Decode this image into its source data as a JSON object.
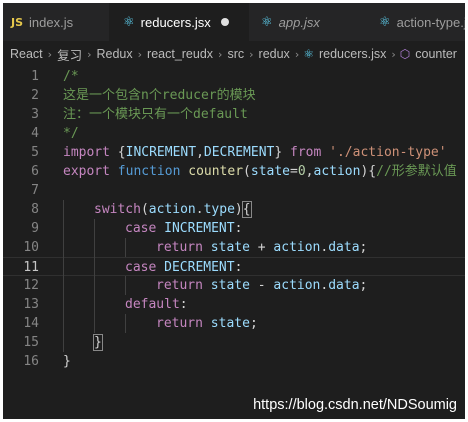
{
  "tabs": [
    {
      "label": "index.js",
      "icon": "js-icon",
      "icon_text": "JS",
      "italic": false,
      "active": false,
      "dirty": false
    },
    {
      "label": "reducers.jsx",
      "icon": "react-icon",
      "icon_text": "⚛",
      "italic": false,
      "active": true,
      "dirty": true
    },
    {
      "label": "app.jsx",
      "icon": "react-icon",
      "icon_text": "⚛",
      "italic": true,
      "active": false,
      "dirty": false
    },
    {
      "label": "action-type.js",
      "icon": "react-icon",
      "icon_text": "⚛",
      "italic": false,
      "active": false,
      "dirty": false
    }
  ],
  "breadcrumb": {
    "items": [
      "React",
      "复习",
      "Redux",
      "react_reudx",
      "src",
      "redux",
      "reducers.jsx",
      "counter"
    ],
    "file_icon": "react-icon",
    "symbol_icon": "cube-icon"
  },
  "editor": {
    "current_line": 11,
    "lines": [
      {
        "n": "1",
        "indent": 0,
        "tokens": [
          {
            "t": "/*",
            "c": "comment"
          }
        ]
      },
      {
        "n": "2",
        "indent": 0,
        "tokens": [
          {
            "t": "这是一个包含n个reducer的模块",
            "c": "comment"
          }
        ]
      },
      {
        "n": "3",
        "indent": 0,
        "tokens": [
          {
            "t": "注：一个模块只有一个default",
            "c": "comment"
          }
        ]
      },
      {
        "n": "4",
        "indent": 0,
        "tokens": [
          {
            "t": "*/",
            "c": "comment"
          }
        ]
      },
      {
        "n": "5",
        "indent": 0,
        "tokens": [
          {
            "t": "import",
            "c": "ctrl"
          },
          {
            "t": " {",
            "c": "punct"
          },
          {
            "t": "INCREMENT",
            "c": "var"
          },
          {
            "t": ",",
            "c": "punct"
          },
          {
            "t": "DECREMENT",
            "c": "var"
          },
          {
            "t": "} ",
            "c": "punct"
          },
          {
            "t": "from",
            "c": "ctrl"
          },
          {
            "t": " ",
            "c": "punct"
          },
          {
            "t": "'./action-type'",
            "c": "str"
          }
        ]
      },
      {
        "n": "6",
        "indent": 0,
        "tokens": [
          {
            "t": "export",
            "c": "ctrl"
          },
          {
            "t": " ",
            "c": "punct"
          },
          {
            "t": "function",
            "c": "kw"
          },
          {
            "t": " ",
            "c": "punct"
          },
          {
            "t": "counter",
            "c": "fn"
          },
          {
            "t": "(",
            "c": "punct"
          },
          {
            "t": "state",
            "c": "var"
          },
          {
            "t": "=",
            "c": "punct"
          },
          {
            "t": "0",
            "c": "num"
          },
          {
            "t": ",",
            "c": "punct"
          },
          {
            "t": "action",
            "c": "var"
          },
          {
            "t": "){",
            "c": "punct"
          },
          {
            "t": "//形参默认值",
            "c": "comment"
          }
        ]
      },
      {
        "n": "7",
        "indent": 0,
        "tokens": []
      },
      {
        "n": "8",
        "indent": 1,
        "tokens": [
          {
            "t": "switch",
            "c": "ctrl"
          },
          {
            "t": "(",
            "c": "punct"
          },
          {
            "t": "action",
            "c": "var"
          },
          {
            "t": ".",
            "c": "punct"
          },
          {
            "t": "type",
            "c": "var"
          },
          {
            "t": ")",
            "c": "punct"
          },
          {
            "t": "{",
            "c": "brace"
          }
        ]
      },
      {
        "n": "9",
        "indent": 2,
        "tokens": [
          {
            "t": "case",
            "c": "ctrl"
          },
          {
            "t": " ",
            "c": "punct"
          },
          {
            "t": "INCREMENT",
            "c": "var"
          },
          {
            "t": ":",
            "c": "punct"
          }
        ]
      },
      {
        "n": "10",
        "indent": 3,
        "tokens": [
          {
            "t": "return",
            "c": "ctrl"
          },
          {
            "t": " ",
            "c": "punct"
          },
          {
            "t": "state",
            "c": "var"
          },
          {
            "t": " + ",
            "c": "punct"
          },
          {
            "t": "action",
            "c": "var"
          },
          {
            "t": ".",
            "c": "punct"
          },
          {
            "t": "data",
            "c": "var"
          },
          {
            "t": ";",
            "c": "punct"
          }
        ]
      },
      {
        "n": "11",
        "indent": 2,
        "tokens": [
          {
            "t": "case",
            "c": "ctrl"
          },
          {
            "t": " ",
            "c": "punct"
          },
          {
            "t": "DECREMENT",
            "c": "var"
          },
          {
            "t": ":",
            "c": "punct"
          }
        ]
      },
      {
        "n": "12",
        "indent": 3,
        "tokens": [
          {
            "t": "return",
            "c": "ctrl"
          },
          {
            "t": " ",
            "c": "punct"
          },
          {
            "t": "state",
            "c": "var"
          },
          {
            "t": " - ",
            "c": "punct"
          },
          {
            "t": "action",
            "c": "var"
          },
          {
            "t": ".",
            "c": "punct"
          },
          {
            "t": "data",
            "c": "var"
          },
          {
            "t": ";",
            "c": "punct"
          }
        ]
      },
      {
        "n": "13",
        "indent": 2,
        "tokens": [
          {
            "t": "default",
            "c": "ctrl"
          },
          {
            "t": ":",
            "c": "punct"
          }
        ]
      },
      {
        "n": "14",
        "indent": 3,
        "tokens": [
          {
            "t": "return",
            "c": "ctrl"
          },
          {
            "t": " ",
            "c": "punct"
          },
          {
            "t": "state",
            "c": "var"
          },
          {
            "t": ";",
            "c": "punct"
          }
        ]
      },
      {
        "n": "15",
        "indent": 1,
        "tokens": [
          {
            "t": "}",
            "c": "brace"
          }
        ]
      },
      {
        "n": "16",
        "indent": 0,
        "tokens": [
          {
            "t": "}",
            "c": "punct"
          }
        ]
      }
    ]
  },
  "watermark": "https://blog.csdn.net/NDSoumig"
}
